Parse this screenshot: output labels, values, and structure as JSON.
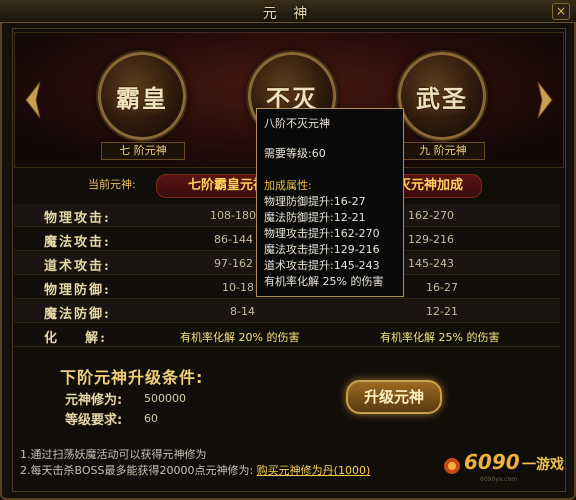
{
  "window": {
    "title": "元 神",
    "close_label": "×"
  },
  "tiers": [
    {
      "name": "霸皇",
      "plate": "七 阶元神"
    },
    {
      "name": "不灭",
      "plate": ""
    },
    {
      "name": "武圣",
      "plate": "九 阶元神"
    }
  ],
  "current": {
    "label": "当前元神:",
    "banner_left": "七阶霸皇元神",
    "banner_right": "八阶不灭元神加成"
  },
  "stats": [
    {
      "label": "物理攻击:",
      "current": "108-180",
      "next": "162-270"
    },
    {
      "label": "魔法攻击:",
      "current": "86-144",
      "next": "129-216"
    },
    {
      "label": "道术攻击:",
      "current": "97-162",
      "next": "145-243"
    },
    {
      "label": "物理防御:",
      "current": "10-18",
      "next": "16-27"
    },
    {
      "label": "魔法防御:",
      "current": "8-14",
      "next": "12-21"
    },
    {
      "label": "化    解:",
      "current": "有机率化解 20% 的伤害",
      "next": "有机率化解 25% 的伤害"
    }
  ],
  "upgrade": {
    "title": "下阶元神升级条件:",
    "cultivation_label": "元神修为:",
    "cultivation_value": "500000",
    "level_label": "等级要求:",
    "level_value": "60",
    "button_label": "升级元神"
  },
  "tips": {
    "tip1": "1.通过扫荡妖魔活动可以获得元神修为",
    "tip2": "2.每天击杀BOSS最多能获得20000点元神修为:",
    "tip2_link": "购买元神修为丹(1000)"
  },
  "logo": {
    "text": "6090",
    "sub": "一游戏",
    "url_text": "6090yx.com"
  },
  "tooltip": {
    "title": "八阶不灭元神",
    "req": "需要等级:60",
    "bonus_header": "加成属性:",
    "lines": [
      "物理防御提升:16-27",
      "魔法防御提升:12-21",
      "物理攻击提升:162-270",
      "魔法攻击提升:129-216",
      "道术攻击提升:145-243",
      "有机率化解 25% 的伤害"
    ]
  },
  "colors": {
    "accent": "#f0d078",
    "banner": "#5a1414",
    "gold": "#ffd25a"
  }
}
